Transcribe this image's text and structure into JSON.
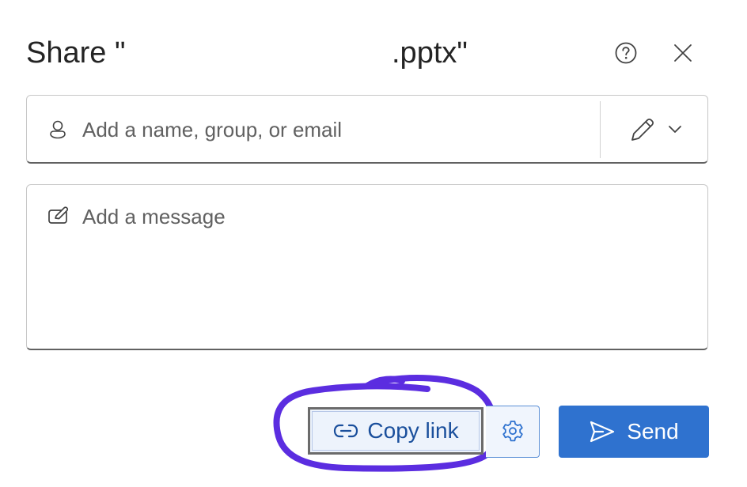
{
  "dialog": {
    "title_prefix": "Share \"",
    "title_suffix": ".pptx\""
  },
  "recipients": {
    "placeholder": "Add a name, group, or email"
  },
  "message": {
    "placeholder": "Add a message"
  },
  "actions": {
    "copy_link_label": "Copy link",
    "send_label": "Send"
  },
  "colors": {
    "accent": "#2f72cf",
    "annotation": "#5b2de0",
    "copy_link_text": "#1a4f9c"
  },
  "icons": {
    "help": "help-circle-icon",
    "close": "close-icon",
    "person": "person-icon",
    "permission": "pencil-icon",
    "dropdown": "chevron-down-icon",
    "message": "edit-note-icon",
    "link": "link-icon",
    "settings": "gear-icon",
    "send": "send-icon"
  }
}
